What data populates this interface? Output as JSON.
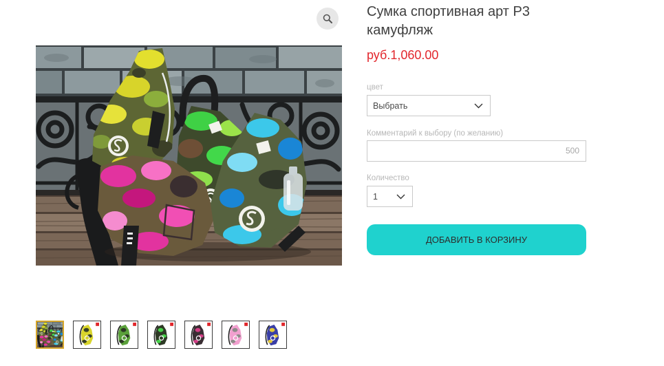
{
  "zoom_button": {
    "icon": "magnifier-icon"
  },
  "product": {
    "title": "Сумка спортивная арт Р3 камуфляж",
    "price": "руб.1,060.00"
  },
  "options": {
    "color": {
      "label": "цвет",
      "selected": "Выбрать",
      "icon": "chevron-down-icon"
    },
    "comment": {
      "label": "Комментарий к выбору (по желанию)",
      "value": "",
      "counter": "500"
    },
    "quantity": {
      "label": "Количество",
      "selected": "1",
      "icon": "chevron-down-icon"
    }
  },
  "cart": {
    "add_button_label": "ДОБАВИТЬ В КОРЗИНУ"
  },
  "gallery": {
    "selected_index": 0,
    "thumbnails": [
      {
        "colors": []
      },
      {
        "colors": [
          "#d9d52c",
          "#3a4226"
        ]
      },
      {
        "colors": [
          "#5aa03a",
          "#2c3824"
        ]
      },
      {
        "colors": [
          "#2f3a26",
          "#46d24a"
        ]
      },
      {
        "colors": [
          "#3a2e33",
          "#d23f86"
        ]
      },
      {
        "colors": [
          "#f2a0cf",
          "#8f8a8a"
        ]
      },
      {
        "colors": [
          "#3a3fa6",
          "#e3c93a"
        ]
      }
    ]
  },
  "colors": {
    "price": "#e2262c",
    "add_button": "#1fd2ce",
    "selected_thumbnail_border": "#d6a62a",
    "thumbnail_badge": "#e0262b"
  }
}
